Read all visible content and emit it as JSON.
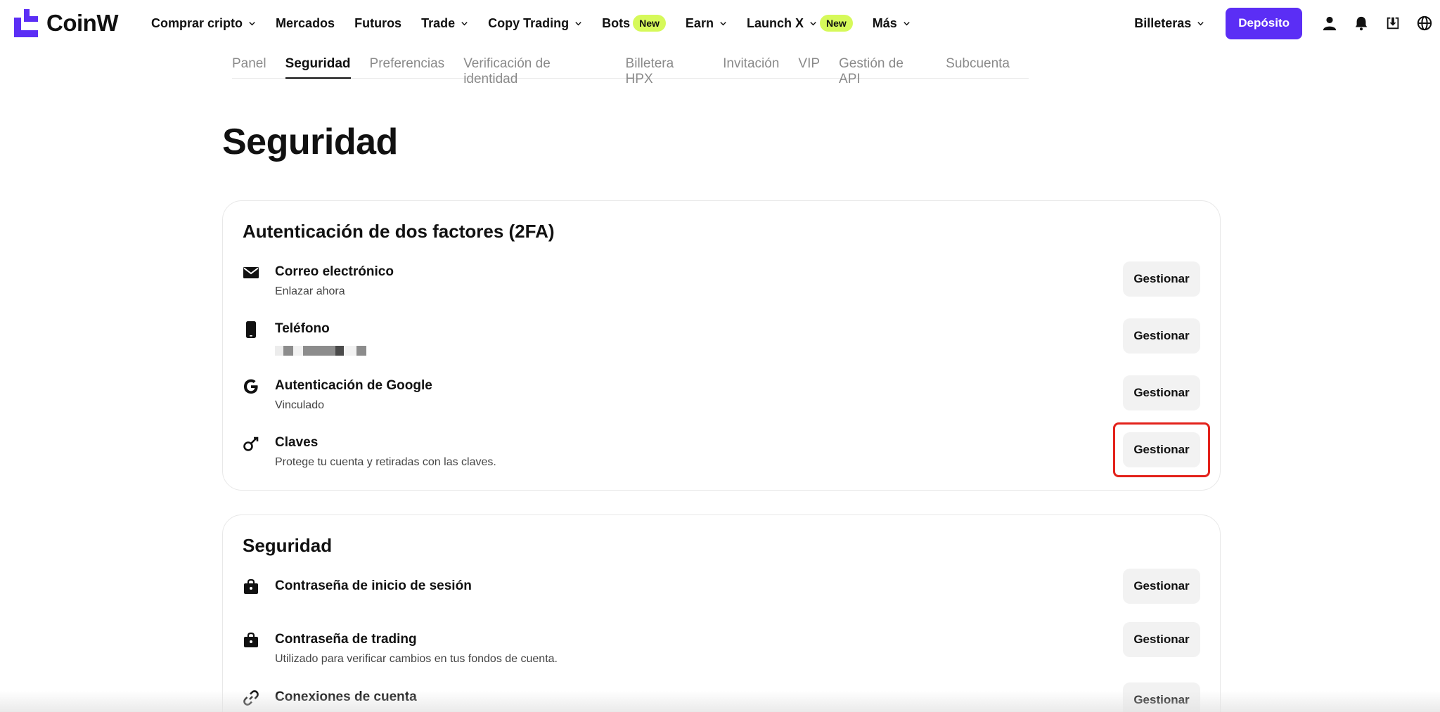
{
  "brand": {
    "name": "CoinW",
    "color": "#5b2ef5"
  },
  "nav": {
    "items": [
      {
        "label": "Comprar cripto",
        "dropdown": true,
        "badge": ""
      },
      {
        "label": "Mercados",
        "dropdown": false,
        "badge": ""
      },
      {
        "label": "Futuros",
        "dropdown": false,
        "badge": ""
      },
      {
        "label": "Trade",
        "dropdown": true,
        "badge": ""
      },
      {
        "label": "Copy Trading",
        "dropdown": true,
        "badge": ""
      },
      {
        "label": "Bots",
        "dropdown": false,
        "badge": "New"
      },
      {
        "label": "Earn",
        "dropdown": true,
        "badge": ""
      },
      {
        "label": "Launch X",
        "dropdown": true,
        "badge": "New"
      },
      {
        "label": "Más",
        "dropdown": true,
        "badge": ""
      }
    ],
    "wallets_label": "Billeteras",
    "deposit_label": "Depósito",
    "icons": [
      "user-icon",
      "bell-icon",
      "download-icon",
      "globe-icon"
    ]
  },
  "subtabs": {
    "items": [
      "Panel",
      "Seguridad",
      "Preferencias",
      "Verificación de identidad",
      "Billetera HPX",
      "Invitación",
      "VIP",
      "Gestión de API",
      "Subcuenta"
    ],
    "active": "Seguridad"
  },
  "page": {
    "title": "Seguridad"
  },
  "twofa": {
    "title": "Autenticación de dos factores (2FA)",
    "rows": [
      {
        "icon": "mail-icon",
        "title": "Correo electrónico",
        "subtitle": "Enlazar ahora",
        "button": "Gestionar"
      },
      {
        "icon": "phone-icon",
        "title": "Teléfono",
        "subtitle": "",
        "button": "Gestionar"
      },
      {
        "icon": "google-icon",
        "title": "Autenticación de Google",
        "subtitle": "Vinculado",
        "button": "Gestionar"
      },
      {
        "icon": "key-icon",
        "title": "Claves",
        "subtitle": "Protege tu cuenta y retiradas con las claves.",
        "button": "Gestionar"
      }
    ]
  },
  "security": {
    "title": "Seguridad",
    "rows": [
      {
        "icon": "lock-icon",
        "title": "Contraseña de inicio de sesión",
        "subtitle": "",
        "button": "Gestionar"
      },
      {
        "icon": "lock-icon",
        "title": "Contraseña de trading",
        "subtitle": "Utilizado para verificar cambios en tus fondos de cuenta.",
        "button": "Gestionar"
      },
      {
        "icon": "link-icon",
        "title": "Conexiones de cuenta",
        "subtitle": "",
        "button": "Gestionar"
      }
    ]
  },
  "colors": {
    "accent": "#5b2ef5",
    "badge": "#d6f95a",
    "highlight": "#e3221b",
    "button_bg": "#f2f2f2"
  }
}
